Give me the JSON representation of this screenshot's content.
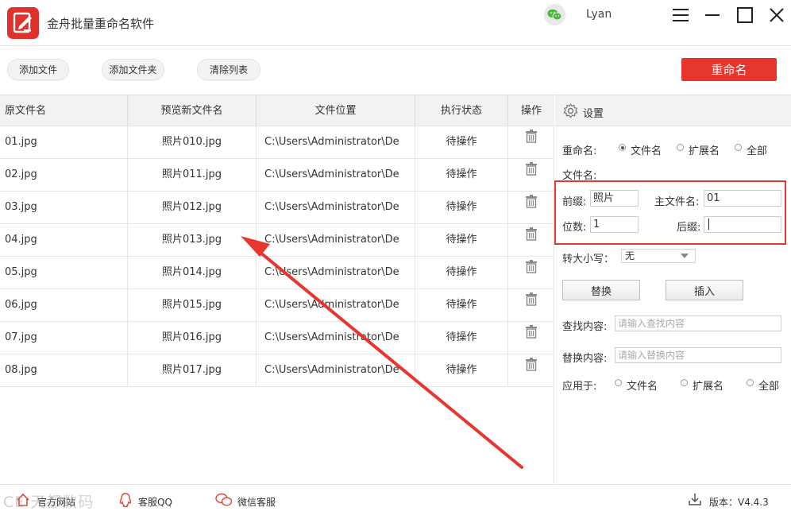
{
  "app": {
    "title": "金舟批量重命名软件",
    "user": "Lyan",
    "accent": "#e53630"
  },
  "toolbar": {
    "add_file": "添加文件",
    "add_folder": "添加文件夹",
    "clear_list": "清除列表",
    "rename": "重命名"
  },
  "table": {
    "headers": [
      "原文件名",
      "预览新文件名",
      "文件位置",
      "执行状态",
      "操作"
    ],
    "rows": [
      {
        "orig": "01.jpg",
        "preview": "照片010.jpg",
        "location": "C:\\Users\\Administrator\\De",
        "status": "待操作"
      },
      {
        "orig": "02.jpg",
        "preview": "照片011.jpg",
        "location": "C:\\Users\\Administrator\\De",
        "status": "待操作"
      },
      {
        "orig": "03.jpg",
        "preview": "照片012.jpg",
        "location": "C:\\Users\\Administrator\\De",
        "status": "待操作"
      },
      {
        "orig": "04.jpg",
        "preview": "照片013.jpg",
        "location": "C:\\Users\\Administrator\\De",
        "status": "待操作"
      },
      {
        "orig": "05.jpg",
        "preview": "照片014.jpg",
        "location": "C:\\Users\\Administrator\\De",
        "status": "待操作"
      },
      {
        "orig": "06.jpg",
        "preview": "照片015.jpg",
        "location": "C:\\Users\\Administrator\\De",
        "status": "待操作"
      },
      {
        "orig": "07.jpg",
        "preview": "照片016.jpg",
        "location": "C:\\Users\\Administrator\\De",
        "status": "待操作"
      },
      {
        "orig": "08.jpg",
        "preview": "照片017.jpg",
        "location": "C:\\Users\\Administrator\\De",
        "status": "待操作"
      }
    ]
  },
  "settings": {
    "title": "设置",
    "rename_label": "重命名:",
    "rename_options": [
      "文件名",
      "扩展名",
      "全部"
    ],
    "rename_selected": "文件名",
    "filename_label": "文件名:",
    "prefix_label": "前缀:",
    "prefix_value": "照片",
    "main_name_label": "主文件名:",
    "main_name_value": "01",
    "digits_label": "位数:",
    "digits_value": "1",
    "suffix_label": "后缀:",
    "suffix_value": "",
    "case_label": "转大小写：",
    "case_value": "无",
    "replace_button": "替换",
    "insert_button": "插入",
    "find_label": "查找内容:",
    "find_placeholder": "请输入查找内容",
    "replace_label": "替换内容:",
    "replace_placeholder": "请输入替换内容",
    "apply_label": "应用于:",
    "apply_options": [
      "文件名",
      "扩展名",
      "全部"
    ]
  },
  "footer": {
    "website": "官方网站",
    "qq": "客服QQ",
    "wechat": "微信客服",
    "version": "版本：V4.4.3",
    "watermark": "CE 天都数码"
  }
}
